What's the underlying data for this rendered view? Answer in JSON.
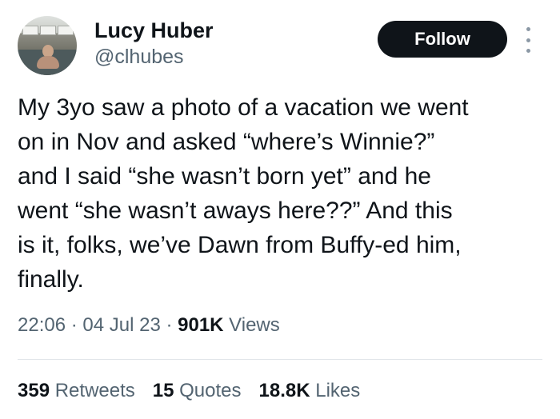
{
  "author": {
    "name": "Lucy Huber",
    "handle": "@clhubes"
  },
  "actions": {
    "follow_label": "Follow",
    "more_icon": "more-options-icon"
  },
  "tweet": {
    "lines": [
      "My 3yo saw a photo of a vacation we went",
      "on in Nov and asked “where’s Winnie?”",
      "and I said “she wasn’t born yet” and he",
      "went “she wasn’t aways here??” And this",
      "is it, folks, we’ve Dawn from Buffy-ed him,",
      "finally."
    ]
  },
  "meta": {
    "time": "22:06",
    "separator": " · ",
    "date": "04 Jul 23",
    "views_count": "901K",
    "views_label": " Views"
  },
  "stats": {
    "retweets_count": "359",
    "retweets_label": " Retweets",
    "quotes_count": "15",
    "quotes_label": " Quotes",
    "likes_count": "18.8K",
    "likes_label": " Likes"
  },
  "colors": {
    "text_primary": "#0f1419",
    "text_secondary": "#536471",
    "follow_bg": "#0f1419",
    "follow_text": "#ffffff",
    "divider": "#e1e6ea"
  }
}
